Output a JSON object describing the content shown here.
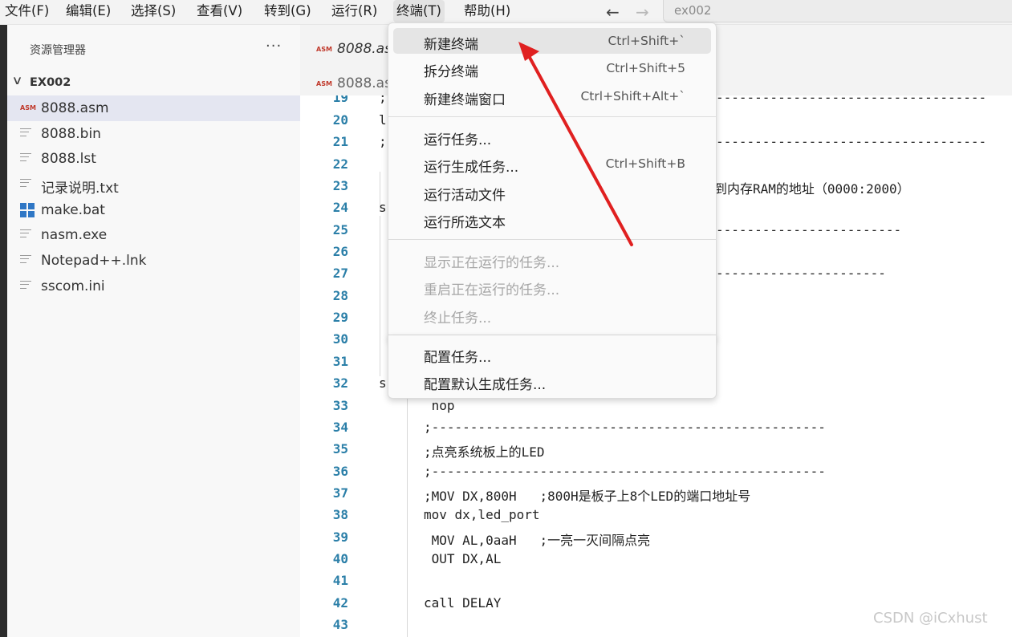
{
  "menubar": {
    "items": [
      "文件(F)",
      "编辑(E)",
      "选择(S)",
      "查看(V)",
      "转到(G)",
      "运行(R)",
      "终端(T)",
      "帮助(H)"
    ],
    "back_icon": "arrow-left-icon",
    "forward_icon": "arrow-right-icon",
    "search_text": "ex002"
  },
  "sidebar": {
    "title": "资源管理器",
    "more": "···",
    "folder": "EX002",
    "files": [
      {
        "name": "8088.asm",
        "icon": "asm-file-icon"
      },
      {
        "name": "8088.bin",
        "icon": "text-file-icon"
      },
      {
        "name": "8088.lst",
        "icon": "text-file-icon"
      },
      {
        "name": "记录说明.txt",
        "icon": "text-file-icon"
      },
      {
        "name": "make.bat",
        "icon": "windows-icon"
      },
      {
        "name": "nasm.exe",
        "icon": "text-file-icon"
      },
      {
        "name": "Notepad++.lnk",
        "icon": "text-file-icon"
      },
      {
        "name": "sscom.ini",
        "icon": "text-file-icon"
      }
    ]
  },
  "editor": {
    "tabs": [
      "8088.asm",
      "8088.asm"
    ],
    "asm_badge": "ASM",
    "line_numbers": [
      "19",
      "20",
      "21",
      "22",
      "23",
      "24",
      "25",
      "26",
      "27",
      "28",
      "29",
      "30",
      "31",
      "32",
      "33",
      "34",
      "35",
      "36",
      "37",
      "38",
      "39",
      "40",
      "41",
      "42",
      "43"
    ],
    "partial": {
      "l19": ";",
      "l20": "l",
      "l21": ";",
      "l24": "s",
      "l32": "s",
      "dash19": "-----------------------------------",
      "dash21": "-----------------------------------",
      "text23": "到内存RAM的地址（0000:2000）",
      "dash25": "------------------------",
      "dash27": "----------------------"
    },
    "code": [
      " nop",
      ";---------------------------------------------------",
      ";点亮系统板上的LED",
      ";---------------------------------------------------",
      ";MOV DX,800H   ;800H是板子上8个LED的端口地址号",
      "mov dx,led_port",
      " MOV AL,0aaH   ;一亮一灭间隔点亮",
      " OUT DX,AL",
      "",
      "call DELAY",
      ""
    ]
  },
  "dropdown": {
    "group1": [
      {
        "label": "新建终端",
        "shortcut": "Ctrl+Shift+`"
      },
      {
        "label": "拆分终端",
        "shortcut": "Ctrl+Shift+5"
      },
      {
        "label": "新建终端窗口",
        "shortcut": "Ctrl+Shift+Alt+`"
      }
    ],
    "group2": [
      {
        "label": "运行任务...",
        "shortcut": ""
      },
      {
        "label": "运行生成任务...",
        "shortcut": "Ctrl+Shift+B"
      },
      {
        "label": "运行活动文件",
        "shortcut": ""
      },
      {
        "label": "运行所选文本",
        "shortcut": ""
      }
    ],
    "group3": [
      {
        "label": "显示正在运行的任务...",
        "shortcut": ""
      },
      {
        "label": "重启正在运行的任务...",
        "shortcut": ""
      },
      {
        "label": "终止任务...",
        "shortcut": ""
      }
    ],
    "group4": [
      {
        "label": "配置任务...",
        "shortcut": ""
      },
      {
        "label": "配置默认生成任务...",
        "shortcut": ""
      }
    ]
  },
  "annotation": {
    "color": "#e02020"
  },
  "watermark": "CSDN @iCxhust"
}
